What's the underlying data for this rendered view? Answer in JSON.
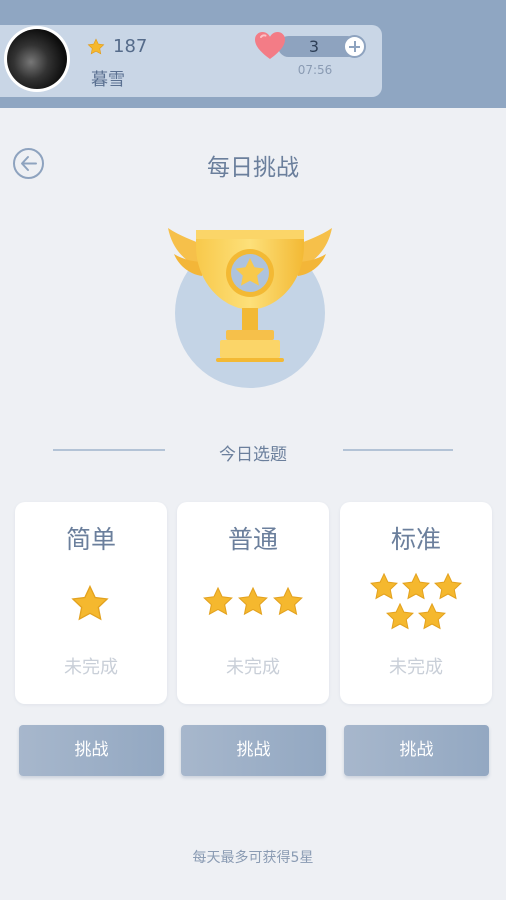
{
  "header": {
    "score": "187",
    "username": "暮雪",
    "lives": "3",
    "timer": "07:56"
  },
  "page": {
    "title": "每日挑战"
  },
  "section": {
    "title": "今日选题"
  },
  "cards": [
    {
      "title": "简单",
      "stars": 1,
      "status": "未完成",
      "button": "挑战"
    },
    {
      "title": "普通",
      "stars": 3,
      "status": "未完成",
      "button": "挑战"
    },
    {
      "title": "标准",
      "stars": 5,
      "status": "未完成",
      "button": "挑战"
    }
  ],
  "footer": {
    "note": "每天最多可获得5星"
  },
  "colors": {
    "topbar": "#8fa6c2",
    "accent": "#93a8c2",
    "star": "#f5b82e",
    "heart": "#f37c86"
  }
}
